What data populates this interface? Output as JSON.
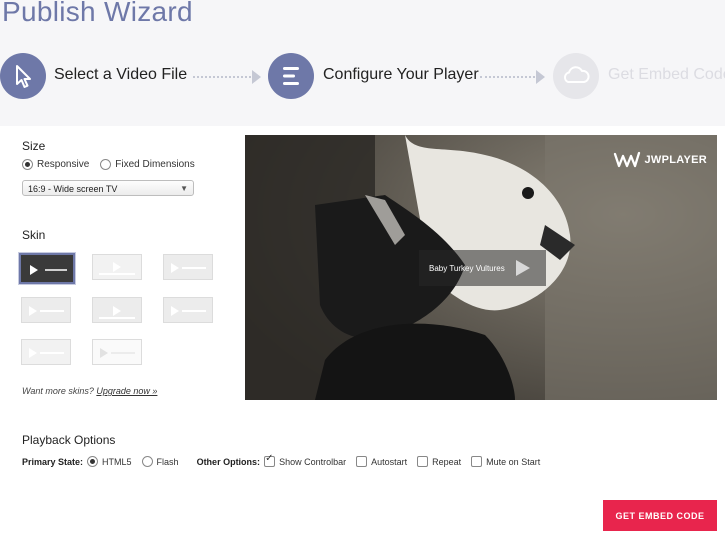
{
  "wizard": {
    "title": "Publish Wizard",
    "steps": [
      {
        "label": "Select a Video File",
        "icon": "cursor-icon",
        "state": "done"
      },
      {
        "label": "Configure Your Player",
        "icon": "list-icon",
        "state": "active"
      },
      {
        "label": "Get Embed Code",
        "icon": "cloud-icon",
        "state": "inactive"
      }
    ]
  },
  "size": {
    "heading": "Size",
    "options": [
      {
        "label": "Responsive",
        "selected": true
      },
      {
        "label": "Fixed Dimensions",
        "selected": false
      }
    ],
    "aspect_select": {
      "value": "16:9 - Wide screen TV"
    }
  },
  "skin": {
    "heading": "Skin",
    "count": 8,
    "selected_index": 0,
    "more_prefix": "Want more skins?",
    "upgrade_link": "Upgrade now »"
  },
  "player": {
    "logo_text": "JWPLAYER",
    "video_title": "Baby Turkey Vultures"
  },
  "playback": {
    "heading": "Playback Options",
    "primary_state_label": "Primary State:",
    "primary_states": [
      {
        "label": "HTML5",
        "selected": true
      },
      {
        "label": "Flash",
        "selected": false
      }
    ],
    "other_options_label": "Other Options:",
    "other_options": [
      {
        "label": "Show Controlbar",
        "checked": true
      },
      {
        "label": "Autostart",
        "checked": false
      },
      {
        "label": "Repeat",
        "checked": false
      },
      {
        "label": "Mute on Start",
        "checked": false
      }
    ]
  },
  "actions": {
    "embed_button": "GET EMBED CODE"
  },
  "colors": {
    "accent": "#6e78a8",
    "cta": "#e8254d",
    "step_inactive": "#e6e6ea"
  }
}
